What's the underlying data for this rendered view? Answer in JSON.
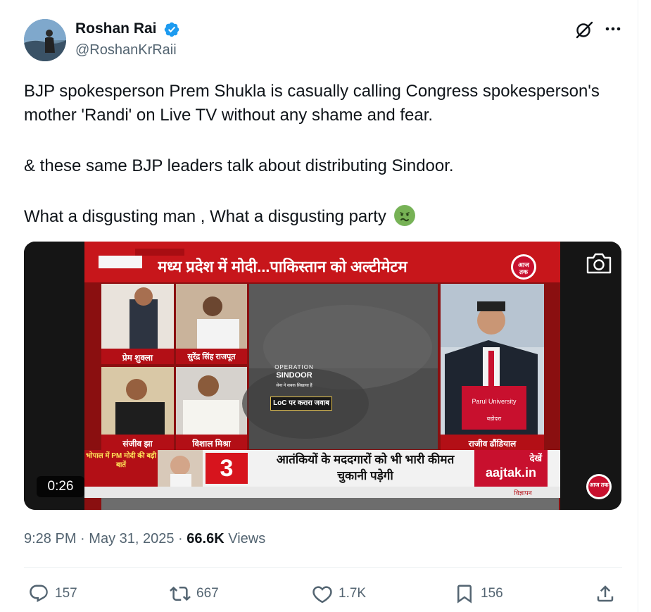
{
  "author": {
    "name": "Roshan Rai",
    "handle": "@RoshanKrRaii",
    "verified": true
  },
  "tweet": {
    "paragraphs": [
      "BJP spokesperson Prem Shukla is casually calling Congress spokesperson's mother 'Randi' on Live TV without any shame and fear.",
      "& these same BJP leaders talk about distributing Sindoor.",
      "What a disgusting man , What a disgusting party"
    ],
    "emoji": "nauseated-face"
  },
  "video": {
    "duration": "0:26",
    "headline": "मध्य प्रदेश में मोदी...पाकिस्तान को अल्टीमेटम",
    "channel_logo": "आज तक",
    "operation_label": "OPERATION",
    "operation_name": "SINDOOR",
    "operation_sub": "सेना ने सबक सिखाया हैं",
    "loc_label": "LoC पर करारा जवाब",
    "panelists": [
      "प्रेम शुक्ला",
      "सुरेंद्र सिंह राजपूत",
      "संजीव झा",
      "विशाल मिश्रा"
    ],
    "anchor_name": "राजीव ढौंडियाल",
    "podium_brand": "Parul University",
    "podium_sub": "वडोदरा",
    "ticker_left": "भोपाल में PM मोदी की बड़ी बातें",
    "ticker_number": "3",
    "ticker_text": "आतंकियों के मददगारों को भी भारी कीमत चुकानी पड़ेगी",
    "website_label_top": "देखें",
    "website_label": "aajtak.in",
    "ad_label": "विज्ञापन"
  },
  "meta": {
    "time": "9:28 PM",
    "separator": "·",
    "date": "May 31, 2025",
    "views_count": "66.6K",
    "views_label": "Views"
  },
  "actions": {
    "replies": "157",
    "reposts": "667",
    "likes": "1.7K",
    "bookmarks": "156"
  },
  "colors": {
    "text": "#0f1419",
    "secondary": "#536471",
    "verified": "#1d9bf0",
    "aajtak_red": "#c8102e"
  }
}
